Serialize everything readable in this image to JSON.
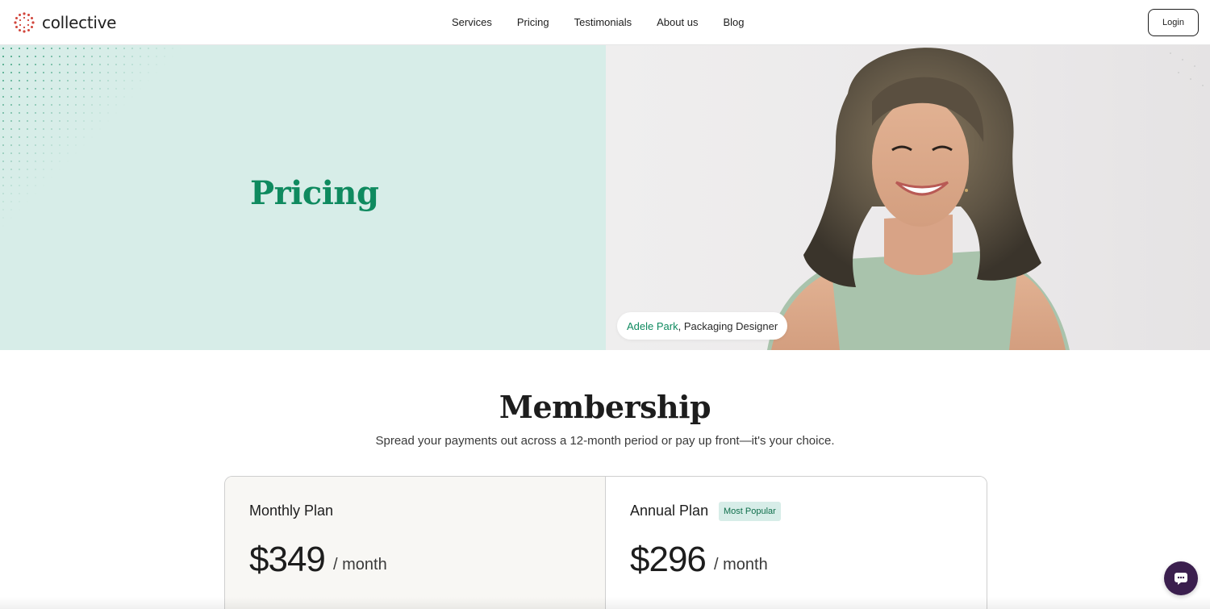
{
  "brand": {
    "name": "collective"
  },
  "nav": {
    "items": [
      {
        "label": "Services"
      },
      {
        "label": "Pricing"
      },
      {
        "label": "Testimonials"
      },
      {
        "label": "About us"
      },
      {
        "label": "Blog"
      }
    ],
    "login_label": "Login"
  },
  "hero": {
    "title": "Pricing",
    "caption_name": "Adele Park",
    "caption_role": ", Packaging Designer"
  },
  "membership": {
    "title": "Membership",
    "subtitle": "Spread your payments out across a 12-month period or pay up front—it's your choice.",
    "plans": [
      {
        "name": "Monthly Plan",
        "price": "$349",
        "period": "/ month"
      },
      {
        "name": "Annual Plan",
        "badge": "Most Popular",
        "price": "$296",
        "period": "/ month"
      }
    ]
  },
  "colors": {
    "accent": "#0f8a5f",
    "hero_bg": "#d7ede8",
    "chat_button": "#3b1f4e"
  },
  "icons": {
    "logo": "collective-logo-mark",
    "chat": "chat-bubble-icon"
  }
}
